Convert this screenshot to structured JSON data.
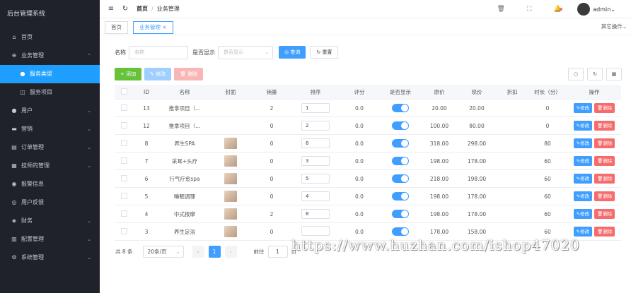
{
  "sidebar": {
    "brand": "后台管理系统",
    "items": [
      {
        "label": "首页",
        "icon": "home-icon",
        "glyph": "⌂",
        "chevron": false,
        "sub": false,
        "active": false
      },
      {
        "label": "业务管理",
        "icon": "plus-circle-icon",
        "glyph": "⊕",
        "chevron": true,
        "chevron_glyph": "⌃",
        "sub": false,
        "active": false
      },
      {
        "label": "服务类型",
        "icon": "dot-icon",
        "glyph": "●",
        "chevron": false,
        "sub": true,
        "active": true
      },
      {
        "label": "服务项目",
        "icon": "bag-icon",
        "glyph": "◫",
        "chevron": false,
        "sub": true,
        "active": false
      },
      {
        "label": "用户",
        "icon": "user-icon",
        "glyph": "●",
        "chevron": true,
        "chevron_glyph": "⌄",
        "sub": false,
        "active": false
      },
      {
        "label": "营销",
        "icon": "ticket-icon",
        "glyph": "▬",
        "chevron": true,
        "chevron_glyph": "⌄",
        "sub": false,
        "active": false
      },
      {
        "label": "订单管理",
        "icon": "cart-icon",
        "glyph": "▤",
        "chevron": true,
        "chevron_glyph": "⌄",
        "sub": false,
        "active": false
      },
      {
        "label": "技师的管理",
        "icon": "grid-icon",
        "glyph": "▦",
        "chevron": true,
        "chevron_glyph": "⌄",
        "sub": false,
        "active": false
      },
      {
        "label": "报警信息",
        "icon": "location-icon",
        "glyph": "◉",
        "chevron": false,
        "sub": false,
        "active": false
      },
      {
        "label": "用户反馈",
        "icon": "feedback-icon",
        "glyph": "◎",
        "chevron": false,
        "sub": false,
        "active": false
      },
      {
        "label": "财务",
        "icon": "finance-icon",
        "glyph": "◈",
        "chevron": true,
        "chevron_glyph": "⌄",
        "sub": false,
        "active": false
      },
      {
        "label": "配置管理",
        "icon": "chart-icon",
        "glyph": "▥",
        "chevron": true,
        "chevron_glyph": "⌄",
        "sub": false,
        "active": false
      },
      {
        "label": "系统管理",
        "icon": "gear-icon",
        "glyph": "⚙",
        "chevron": true,
        "chevron_glyph": "⌄",
        "sub": false,
        "active": false
      }
    ]
  },
  "topbar": {
    "menu_glyph": "≡",
    "refresh_glyph": "↻",
    "breadcrumb_home": "首页",
    "breadcrumb_sep": "/",
    "breadcrumb_current": "业务管理",
    "trash_glyph": "🗑",
    "fullscreen_glyph": "⛶",
    "bell_glyph": "🔔",
    "username": "admin",
    "user_chevron": "⌄"
  },
  "tabs": {
    "home": "首页",
    "current": "业务管理",
    "current_close": "×",
    "other_ops": "其它操作",
    "other_ops_glyph": "⌄"
  },
  "search": {
    "name_label": "名称",
    "name_placeholder": "名称",
    "show_label": "是否显示",
    "show_placeholder": "是否显示",
    "select_arrow": "⌄",
    "search_button": "◎ 查询",
    "reset_button": "↻ 重置"
  },
  "toolbar": {
    "add": "+ 添加",
    "edit": "✎ 修改",
    "delete": "🗑 删除",
    "search_toggle": "○",
    "refresh": "↻",
    "columns": "▦"
  },
  "table": {
    "headers": {
      "id": "ID",
      "name": "名称",
      "cover": "封面",
      "sales": "销量",
      "sort": "排序",
      "score": "评分",
      "show": "是否显示",
      "original_price": "原价",
      "current_price": "现价",
      "discount": "折扣",
      "duration": "时长（分）",
      "actions": "操作"
    },
    "edit_label": "✎修改",
    "delete_label": "🗑删除",
    "rows": [
      {
        "id": "13",
        "name": "推拿项目（...",
        "cover": false,
        "sales": "2",
        "sort": "1",
        "score": "0.0",
        "show": true,
        "original_price": "20.00",
        "current_price": "20.00",
        "discount": "",
        "duration": "0"
      },
      {
        "id": "12",
        "name": "推拿项目（...",
        "cover": false,
        "sales": "0",
        "sort": "2",
        "score": "0.0",
        "show": true,
        "original_price": "100.00",
        "current_price": "80.00",
        "discount": "",
        "duration": "0"
      },
      {
        "id": "8",
        "name": "养生SPA",
        "cover": true,
        "sales": "0",
        "sort": "6",
        "score": "0.0",
        "show": true,
        "original_price": "318.00",
        "current_price": "298.00",
        "discount": "",
        "duration": "80"
      },
      {
        "id": "7",
        "name": "采耳+头疗",
        "cover": true,
        "sales": "0",
        "sort": "3",
        "score": "0.0",
        "show": true,
        "original_price": "198.00",
        "current_price": "178.00",
        "discount": "",
        "duration": "60"
      },
      {
        "id": "6",
        "name": "行气疗愈spa",
        "cover": true,
        "sales": "0",
        "sort": "5",
        "score": "0.0",
        "show": true,
        "original_price": "218.00",
        "current_price": "198.00",
        "discount": "",
        "duration": "60"
      },
      {
        "id": "5",
        "name": "睡眠调理",
        "cover": true,
        "sales": "0",
        "sort": "4",
        "score": "0.0",
        "show": true,
        "original_price": "198.00",
        "current_price": "178.00",
        "discount": "",
        "duration": "60"
      },
      {
        "id": "4",
        "name": "中式按摩",
        "cover": true,
        "sales": "2",
        "sort": "8",
        "score": "0.0",
        "show": true,
        "original_price": "198.00",
        "current_price": "178.00",
        "discount": "",
        "duration": "60"
      },
      {
        "id": "3",
        "name": "养生足浴",
        "cover": true,
        "sales": "0",
        "sort": "",
        "score": "0.0",
        "show": true,
        "original_price": "178.00",
        "current_price": "158.00",
        "discount": "",
        "duration": "60"
      }
    ]
  },
  "pagination": {
    "total": "共 8 条",
    "page_size": "20条/页",
    "page_size_arrow": "⌄",
    "prev": "‹",
    "current_page": "1",
    "next": "›",
    "goto_prefix": "前往",
    "goto_value": "1",
    "goto_suffix": "页"
  },
  "watermark": "https://www.huzhan.com/ishop47020"
}
